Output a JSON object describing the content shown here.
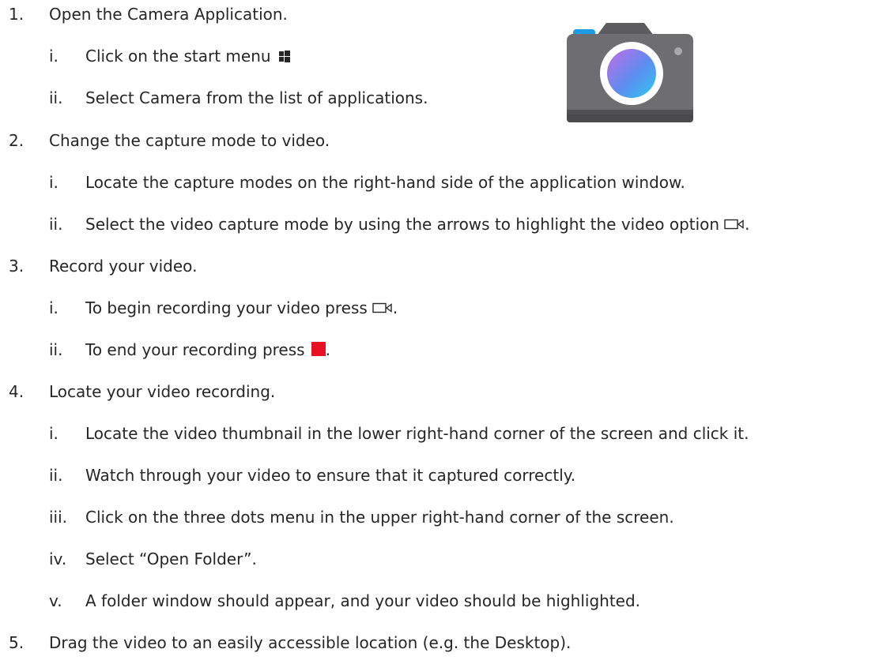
{
  "steps": [
    {
      "number": "1.",
      "text": "Open the Camera Application.",
      "substeps": [
        {
          "numeral": "i.",
          "text": "Click on the start menu",
          "icon": "windows-start-icon"
        },
        {
          "numeral": "ii.",
          "text": "Select Camera from the list of applications."
        }
      ]
    },
    {
      "number": "2.",
      "text": "Change the capture mode to video.",
      "substeps": [
        {
          "numeral": "i.",
          "text": "Locate the capture modes on the right-hand side of the application window."
        },
        {
          "numeral": "ii.",
          "text": "Select the video capture mode by using the arrows to highlight the video option",
          "icon": "video-camera-icon",
          "trail": "."
        }
      ]
    },
    {
      "number": "3.",
      "text": "Record your video.",
      "substeps": [
        {
          "numeral": "i.",
          "text": "To begin recording your video press",
          "icon": "video-camera-icon",
          "trail": "."
        },
        {
          "numeral": "ii.",
          "text": "To end your recording press",
          "icon": "stop-record-icon",
          "trail": "."
        }
      ]
    },
    {
      "number": "4.",
      "text": "Locate your video recording.",
      "substeps": [
        {
          "numeral": "i.",
          "text": "Locate the video thumbnail in the lower right-hand corner of the screen and click it."
        },
        {
          "numeral": "ii.",
          "text": "Watch through your video to ensure that it captured correctly."
        },
        {
          "numeral": "iii.",
          "text": "Click on the three dots menu in the upper right-hand corner of the screen."
        },
        {
          "numeral": "iv.",
          "text": "Select “Open Folder”."
        },
        {
          "numeral": "v.",
          "text": "A folder window should appear, and your video should be highlighted."
        }
      ]
    },
    {
      "number": "5.",
      "text": "Drag the video to an easily accessible location (e.g. the Desktop).",
      "substeps": []
    }
  ],
  "colors": {
    "text": "#262626",
    "stop_icon": "#e81123",
    "camera_body": "#6e6e70",
    "camera_accent": "#1e9be6"
  },
  "icons": {
    "camera_app": "camera-app-icon"
  }
}
